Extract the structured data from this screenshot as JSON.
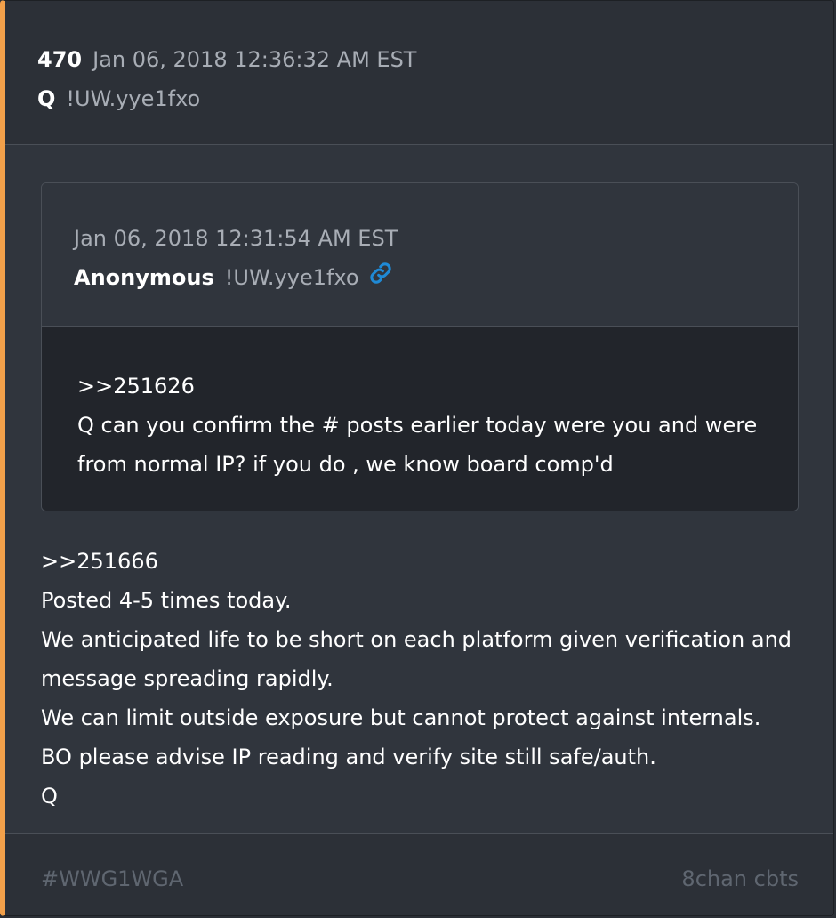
{
  "post": {
    "number": "470",
    "timestamp": "Jan 06, 2018 12:36:32 AM EST",
    "author": "Q",
    "tripcode": "!UW.yye1fxo"
  },
  "quoted": {
    "timestamp": "Jan 06, 2018 12:31:54 AM EST",
    "author": "Anonymous",
    "tripcode": "!UW.yye1fxo",
    "link_icon": "link-icon",
    "lines": [
      ">>251626",
      "Q can you confirm the # posts earlier today were you and were",
      "from normal IP? if you do , we know board comp'd"
    ]
  },
  "body": {
    "lines": [
      ">>251666",
      "Posted 4-5 times today.",
      "We anticipated life to be short on each platform given verification and",
      "message spreading rapidly.",
      "We can limit outside exposure but cannot protect against internals.",
      "BO please advise IP reading and verify site still safe/auth.",
      "Q"
    ]
  },
  "footer": {
    "hashtag": "#WWG1WGA",
    "source": "8chan cbts"
  },
  "colors": {
    "accent": "#f2a04a",
    "link": "#1f8ad6"
  }
}
